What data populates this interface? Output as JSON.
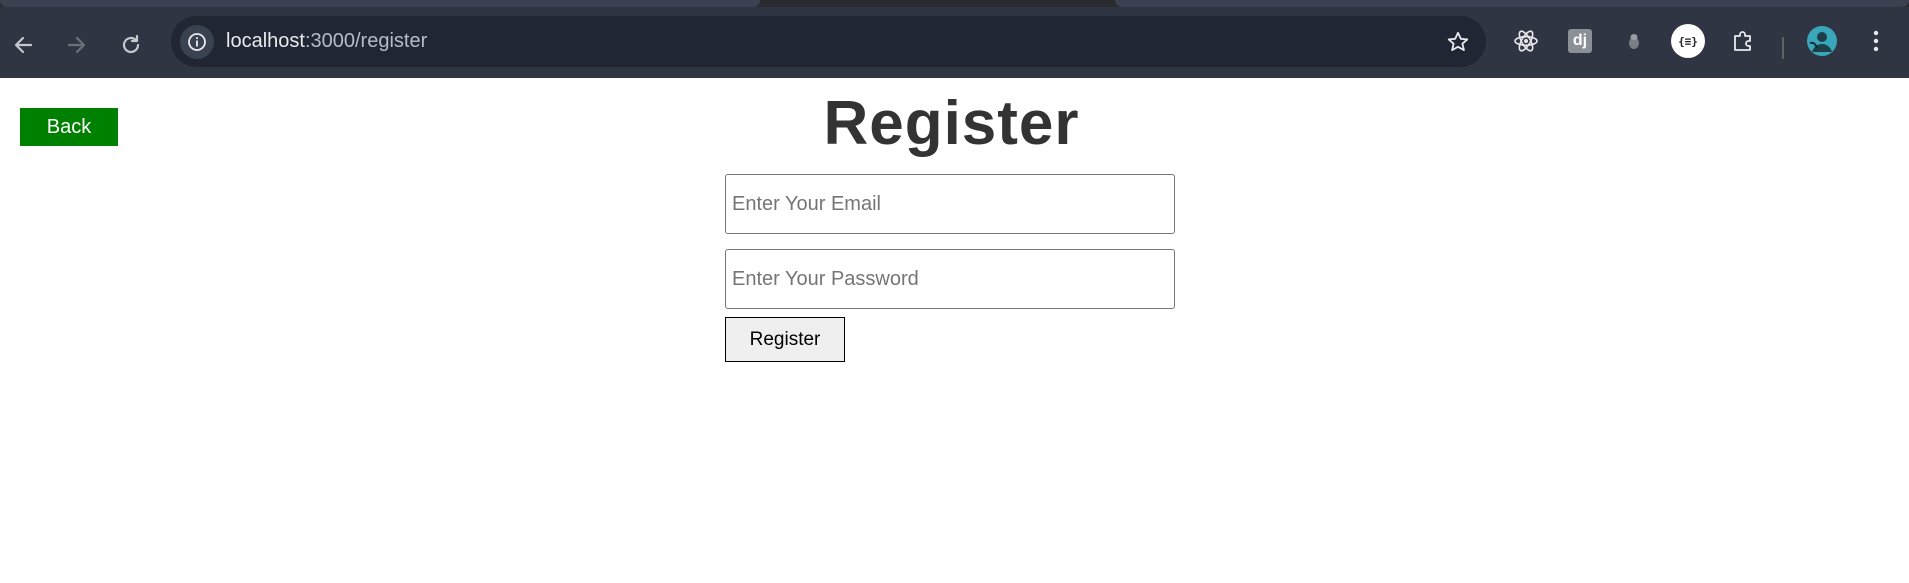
{
  "browser": {
    "url_host": "localhost",
    "url_path": ":3000/register",
    "icons": {
      "back": "arrow-left-icon",
      "forward": "arrow-right-icon",
      "reload": "reload-icon",
      "site_info": "info-icon",
      "bookmark": "star-icon",
      "ext_react": "react-devtools-icon",
      "ext_django": "django-icon",
      "ext_gray": "extension-gray-icon",
      "ext_json": "json-formatter-icon",
      "extensions": "puzzle-icon",
      "profile": "avatar-icon",
      "menu": "kebab-menu-icon"
    },
    "ext_django_label": "dj",
    "ext_json_label": "{≡}"
  },
  "page": {
    "back_label": "Back",
    "title": "Register",
    "email_placeholder": "Enter Your Email",
    "password_placeholder": "Enter Your Password",
    "register_label": "Register"
  },
  "colors": {
    "back_button": "#008000",
    "title": "#333333",
    "toolbar": "#2f3542",
    "omnibox": "#202634"
  }
}
